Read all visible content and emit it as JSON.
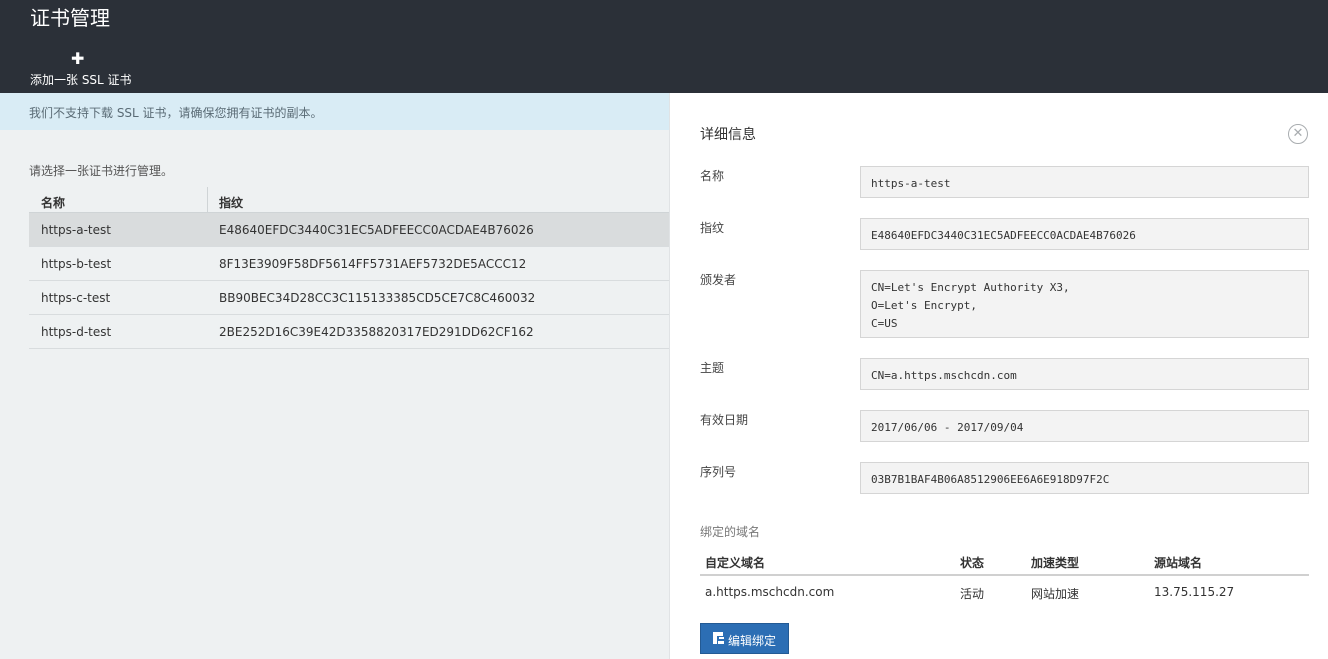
{
  "header": {
    "title": "证书管理",
    "add_label": "添加一张 SSL 证书"
  },
  "left": {
    "notice": "我们不支持下载 SSL 证书，请确保您拥有证书的副本。",
    "hint": "请选择一张证书进行管理。",
    "columns": [
      "名称",
      "指纹"
    ],
    "rows": [
      {
        "name": "https-a-test",
        "fingerprint": "E48640EFDC3440C31EC5ADFEECC0ACDAE4B76026"
      },
      {
        "name": "https-b-test",
        "fingerprint": "8F13E3909F58DF5614FF5731AEF5732DE5ACCC12"
      },
      {
        "name": "https-c-test",
        "fingerprint": "BB90BEC34D28CC3C115133385CD5CE7C8C460032"
      },
      {
        "name": "https-d-test",
        "fingerprint": "2BE252D16C39E42D3358820317ED291DD62CF162"
      }
    ]
  },
  "details": {
    "title": "详细信息",
    "fields": {
      "name": {
        "label": "名称",
        "value": "https-a-test"
      },
      "fingerprint": {
        "label": "指纹",
        "value": "E48640EFDC3440C31EC5ADFEECC0ACDAE4B76026"
      },
      "issuer": {
        "label": "颁发者",
        "lines": [
          "CN=Let's Encrypt Authority X3,",
          "O=Let's Encrypt,",
          "C=US"
        ]
      },
      "subject": {
        "label": "主题",
        "value": "CN=a.https.mschcdn.com"
      },
      "validity": {
        "label": "有效日期",
        "value": "2017/06/06 - 2017/09/04"
      },
      "serial": {
        "label": "序列号",
        "value": "03B7B1BAF4B06A8512906EE6A6E918D97F2C"
      }
    },
    "bound_domains": {
      "title": "绑定的域名",
      "columns": [
        "自定义域名",
        "状态",
        "加速类型",
        "源站域名"
      ],
      "rows": [
        {
          "domain": "a.https.mschcdn.com",
          "status": "活动",
          "type": "网站加速",
          "origin": "13.75.115.27"
        }
      ]
    },
    "edit_label": "编辑绑定"
  }
}
